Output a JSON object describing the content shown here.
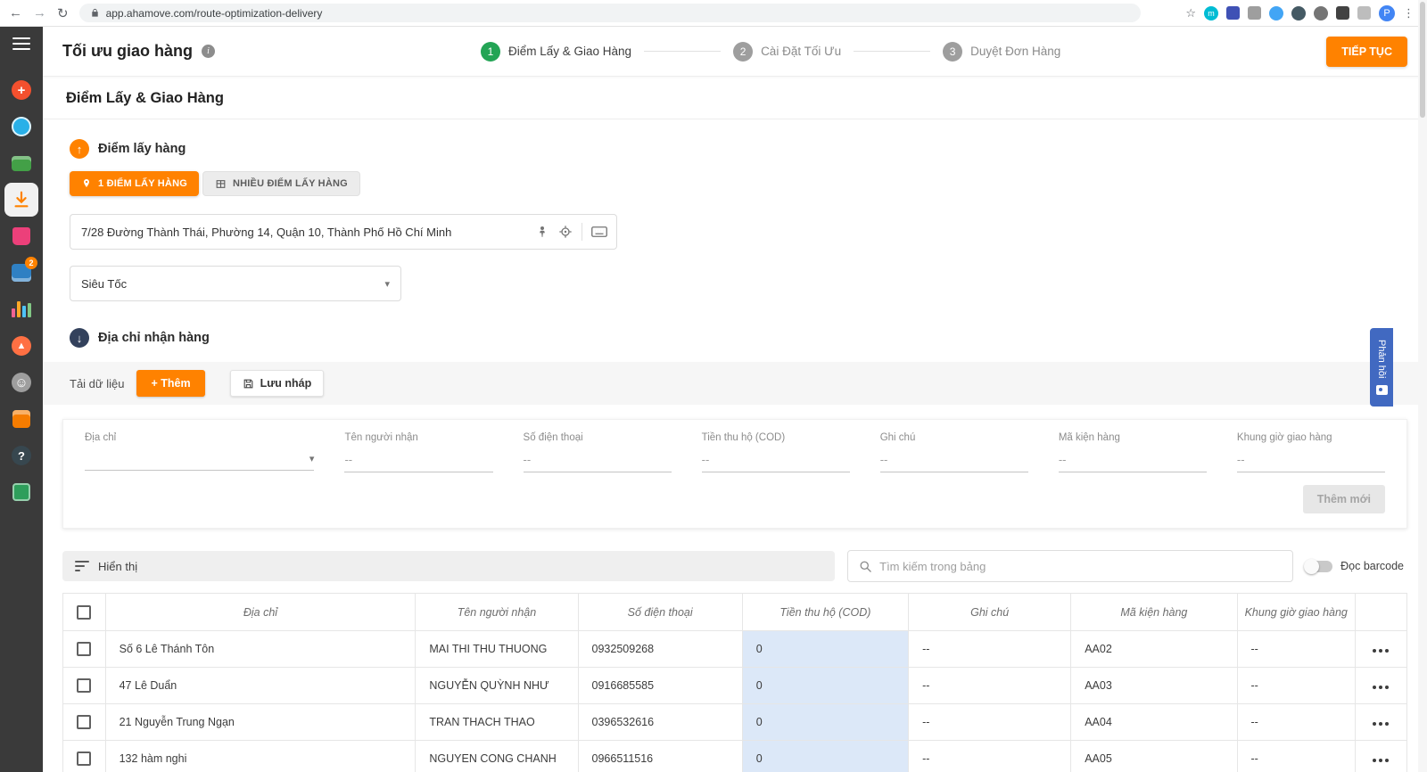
{
  "browser": {
    "url": "app.ahamove.com/route-optimization-delivery"
  },
  "sidebar": {
    "orders_badge": "2"
  },
  "header": {
    "title": "Tối ưu giao hàng",
    "continue_label": "TIẾP TỤC",
    "steps": [
      {
        "num": "1",
        "label": "Điểm Lấy & Giao Hàng"
      },
      {
        "num": "2",
        "label": "Cài Đặt Tối Ưu"
      },
      {
        "num": "3",
        "label": "Duyệt Đơn Hàng"
      }
    ]
  },
  "page": {
    "section_title": "Điểm Lấy & Giao Hàng",
    "pickup": {
      "title": "Điểm lấy hàng",
      "tab_single": "1 ĐIỂM LẤY HÀNG",
      "tab_multiple": "NHIỀU ĐIỂM LẤY HÀNG",
      "address_value": "7/28 Đường Thành Thái, Phường 14, Quận 10, Thành Phố Hồ Chí Minh",
      "service_value": "Siêu Tốc"
    },
    "delivery": {
      "title": "Địa chỉ nhận hàng",
      "load_data_label": "Tải dữ liệu",
      "add_label": "+ Thêm",
      "draft_label": "Lưu nháp",
      "add_new_label": "Thêm mới",
      "fields": [
        {
          "label": "Địa chỉ",
          "value": ""
        },
        {
          "label": "Tên người nhận",
          "value": "--"
        },
        {
          "label": "Số điện thoại",
          "value": "--"
        },
        {
          "label": "Tiền thu hộ (COD)",
          "value": "--"
        },
        {
          "label": "Ghi chú",
          "value": "--"
        },
        {
          "label": "Mã kiện hàng",
          "value": "--"
        },
        {
          "label": "Khung giờ giao hàng",
          "value": "--"
        }
      ]
    },
    "table": {
      "display_label": "Hiển thị",
      "search_placeholder": "Tìm kiếm trong bảng",
      "barcode_label": "Đọc barcode",
      "columns": [
        "Địa chỉ",
        "Tên người nhận",
        "Số điện thoại",
        "Tiền thu hộ (COD)",
        "Ghi chú",
        "Mã kiện hàng",
        "Khung giờ giao hàng"
      ],
      "rows": [
        {
          "address": "Số 6 Lê Thánh Tôn",
          "recipient": "MAI THI THU THUONG",
          "phone": "0932509268",
          "cod": "0",
          "note": "--",
          "package_code": "AA02",
          "time_window": "--"
        },
        {
          "address": "47 Lê Duẩn",
          "recipient": "NGUYỄN QUỲNH NHƯ",
          "phone": "0916685585",
          "cod": "0",
          "note": "--",
          "package_code": "AA03",
          "time_window": "--"
        },
        {
          "address": "21 Nguyễn Trung Ngạn",
          "recipient": "TRAN THACH THAO",
          "phone": "0396532616",
          "cod": "0",
          "note": "--",
          "package_code": "AA04",
          "time_window": "--"
        },
        {
          "address": "132 hàm nghi",
          "recipient": "NGUYEN CONG CHANH",
          "phone": "0966511516",
          "cod": "0",
          "note": "--",
          "package_code": "AA05",
          "time_window": "--"
        }
      ]
    }
  },
  "feedback": {
    "label": "Phản hồi"
  }
}
